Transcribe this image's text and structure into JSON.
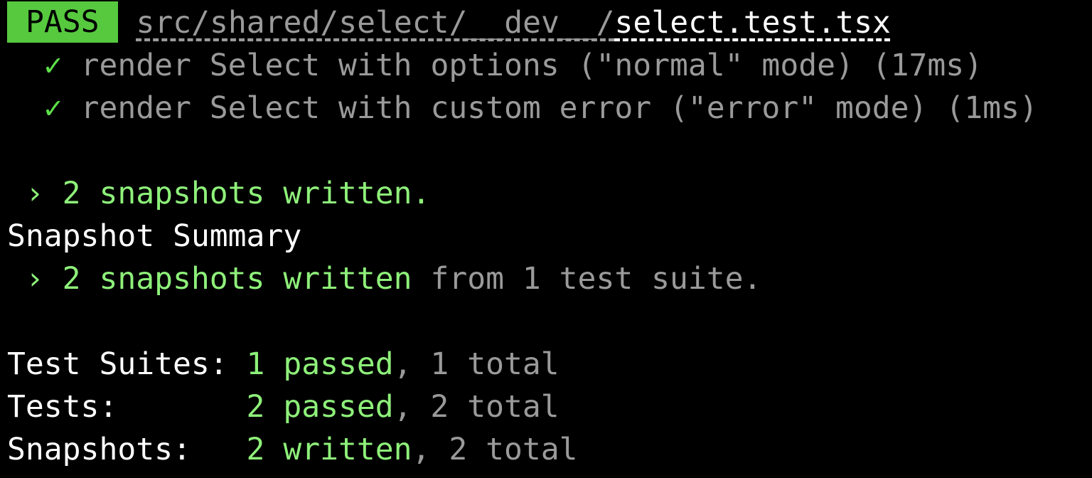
{
  "colors": {
    "background": "#000000",
    "pass_badge": "#56c93f",
    "check": "#5ee04a",
    "success_text": "#8ef07a",
    "dim_text": "#9a9a9a",
    "text": "#ffffff"
  },
  "header": {
    "badge": "PASS",
    "path_dir": "src/shared/select/__dev__/",
    "path_file": "select.test.tsx"
  },
  "tests": [
    {
      "mark": "✓",
      "text": "render Select with options (\"normal\" mode) (17ms)"
    },
    {
      "mark": "✓",
      "text": "render Select with custom error (\"error\" mode) (1ms)"
    }
  ],
  "snapshots_line": {
    "prefix": " › ",
    "text": "2 snapshots written."
  },
  "summary": {
    "title": "Snapshot Summary",
    "prefix": " › ",
    "highlight": "2 snapshots written",
    "rest": " from 1 test suite."
  },
  "stats": [
    {
      "label": "Test Suites: ",
      "value": "1 passed",
      "rest": ", 1 total"
    },
    {
      "label": "Tests:       ",
      "value": "2 passed",
      "rest": ", 2 total"
    },
    {
      "label": "Snapshots:   ",
      "value": "2 written",
      "rest": ", 2 total"
    }
  ]
}
